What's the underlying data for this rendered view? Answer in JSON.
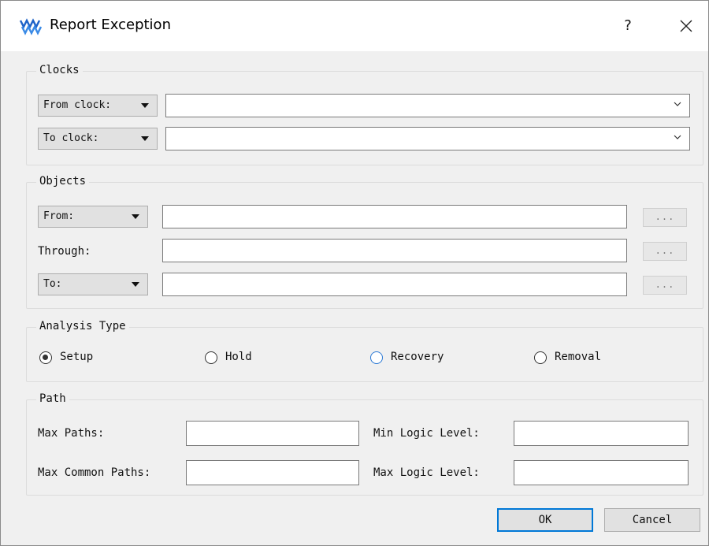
{
  "window": {
    "title": "Report Exception",
    "help_label": "?"
  },
  "clocks": {
    "legend": "Clocks",
    "from_selector": "From clock:",
    "from_value": "",
    "to_selector": "To clock:",
    "to_value": ""
  },
  "objects": {
    "legend": "Objects",
    "from_selector": "From:",
    "from_value": "",
    "through_label": "Through:",
    "through_value": "",
    "to_selector": "To:",
    "to_value": "",
    "browse_label": "..."
  },
  "analysis": {
    "legend": "Analysis Type",
    "options": [
      "Setup",
      "Hold",
      "Recovery",
      "Removal"
    ],
    "selected": "Setup"
  },
  "path": {
    "legend": "Path",
    "max_paths_label": "Max Paths:",
    "max_paths_value": "",
    "max_common_paths_label": "Max Common Paths:",
    "max_common_paths_value": "",
    "min_logic_level_label": "Min Logic Level:",
    "min_logic_level_value": "",
    "max_logic_level_label": "Max Logic Level:",
    "max_logic_level_value": ""
  },
  "buttons": {
    "ok": "OK",
    "cancel": "Cancel"
  },
  "colors": {
    "accent": "#0078d7",
    "logo": "#1e63c8"
  },
  "icons": {
    "app": "gowin-logo-icon",
    "help": "help-icon",
    "close": "close-icon"
  }
}
